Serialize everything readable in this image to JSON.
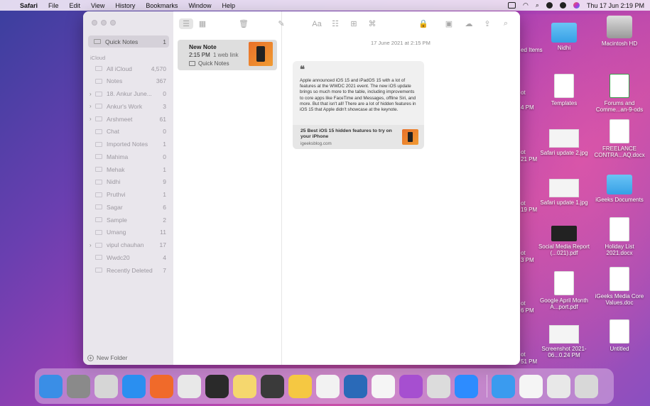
{
  "menubar": {
    "items": [
      "Safari",
      "File",
      "Edit",
      "View",
      "History",
      "Bookmarks",
      "Window",
      "Help"
    ],
    "clock": "Thu 17 Jun  2:19 PM"
  },
  "sidebar": {
    "top_folder": {
      "label": "Quick Notes",
      "count": "1"
    },
    "section": "iCloud",
    "folders": [
      {
        "label": "All iCloud",
        "count": "4,570",
        "expandable": false
      },
      {
        "label": "Notes",
        "count": "367",
        "expandable": false
      },
      {
        "label": "18. Ankur June...",
        "count": "0",
        "expandable": true
      },
      {
        "label": "Ankur's Work",
        "count": "3",
        "expandable": true
      },
      {
        "label": "Arshmeet",
        "count": "61",
        "expandable": true
      },
      {
        "label": "Chat",
        "count": "0",
        "expandable": false
      },
      {
        "label": "Imported Notes",
        "count": "1",
        "expandable": false
      },
      {
        "label": "Mahima",
        "count": "0",
        "expandable": false
      },
      {
        "label": "Mehak",
        "count": "1",
        "expandable": false
      },
      {
        "label": "Nidhi",
        "count": "9",
        "expandable": false
      },
      {
        "label": "Pruthvi",
        "count": "1",
        "expandable": false
      },
      {
        "label": "Sagar",
        "count": "6",
        "expandable": false
      },
      {
        "label": "Sample",
        "count": "2",
        "expandable": false
      },
      {
        "label": "Umang",
        "count": "11",
        "expandable": false
      },
      {
        "label": "vipul chauhan",
        "count": "17",
        "expandable": true
      },
      {
        "label": "Wwdc20",
        "count": "4",
        "expandable": false
      },
      {
        "label": "Recently Deleted",
        "count": "7",
        "expandable": false
      }
    ],
    "new_folder": "New Folder"
  },
  "notelist": {
    "note": {
      "title": "New Note",
      "time": "2:15 PM",
      "links": "1 web link",
      "folder": "Quick Notes"
    }
  },
  "editor": {
    "date": "17 June 2021 at 2:15 PM",
    "quote_mark": "❝",
    "excerpt": "Apple announced iOS 15 and iPadOS 15 with a lot of features at the WWDC 2021 event. The new iOS update brings so much more to the table, including improvements to core apps like FaceTime and Messages, offline Siri, and more. But that isn't all! There are a lot of hidden features in iOS 15 that Apple didn't showcase at the keynote.",
    "link_title": "25 Best iOS 15 hidden features to try on your iPhone",
    "link_domain": "igeeksblog.com"
  },
  "desktop": {
    "icons": [
      {
        "label": "Nidhi",
        "kind": "folder"
      },
      {
        "label": "Macintosh HD",
        "kind": "drive"
      },
      {
        "label": "Templates",
        "kind": "doc"
      },
      {
        "label": "Forums and Comme...an-9-ods",
        "kind": "sheet"
      },
      {
        "label": "Safari update 2.jpg",
        "kind": "screenshot"
      },
      {
        "label": "FREELANCE CONTRA...AQ.docx",
        "kind": "doc"
      },
      {
        "label": "Safari update 1.jpg",
        "kind": "screenshot"
      },
      {
        "label": "iGeeks Documents",
        "kind": "folder"
      },
      {
        "label": "Social Media Report (...021).pdf",
        "kind": "dark"
      },
      {
        "label": "Holiday List 2021.docx",
        "kind": "doc"
      },
      {
        "label": "Google April Month A...port.pdf",
        "kind": "doc"
      },
      {
        "label": "iGeeks Media Core Values.doc",
        "kind": "doc"
      },
      {
        "label": "Screenshot 2021-06...0.24 PM",
        "kind": "screenshot"
      },
      {
        "label": "Untitled",
        "kind": "doc"
      }
    ],
    "partial_labels": [
      "ed Items",
      "ot",
      "4 PM",
      "ot",
      "21 PM",
      "ot",
      "19 PM",
      "ot",
      "3 PM",
      "ot",
      "6 PM",
      "ot",
      "51 PM"
    ]
  },
  "dock": {
    "apps": [
      "Finder",
      "System Preferences",
      "Launchpad",
      "App Store",
      "Firefox",
      "Chrome",
      "Basecamp",
      "Notes",
      "Sublime Text",
      "Reminders",
      "Pages",
      "Thunderbird",
      "TextEdit",
      "Feedback Assistant",
      "Preview",
      "Zoom",
      "Safari",
      "Document",
      "Photo Slideshow",
      "Trash"
    ]
  },
  "colors": {
    "accent": "#f19b32",
    "wallpaper": "#8a4fc0"
  }
}
